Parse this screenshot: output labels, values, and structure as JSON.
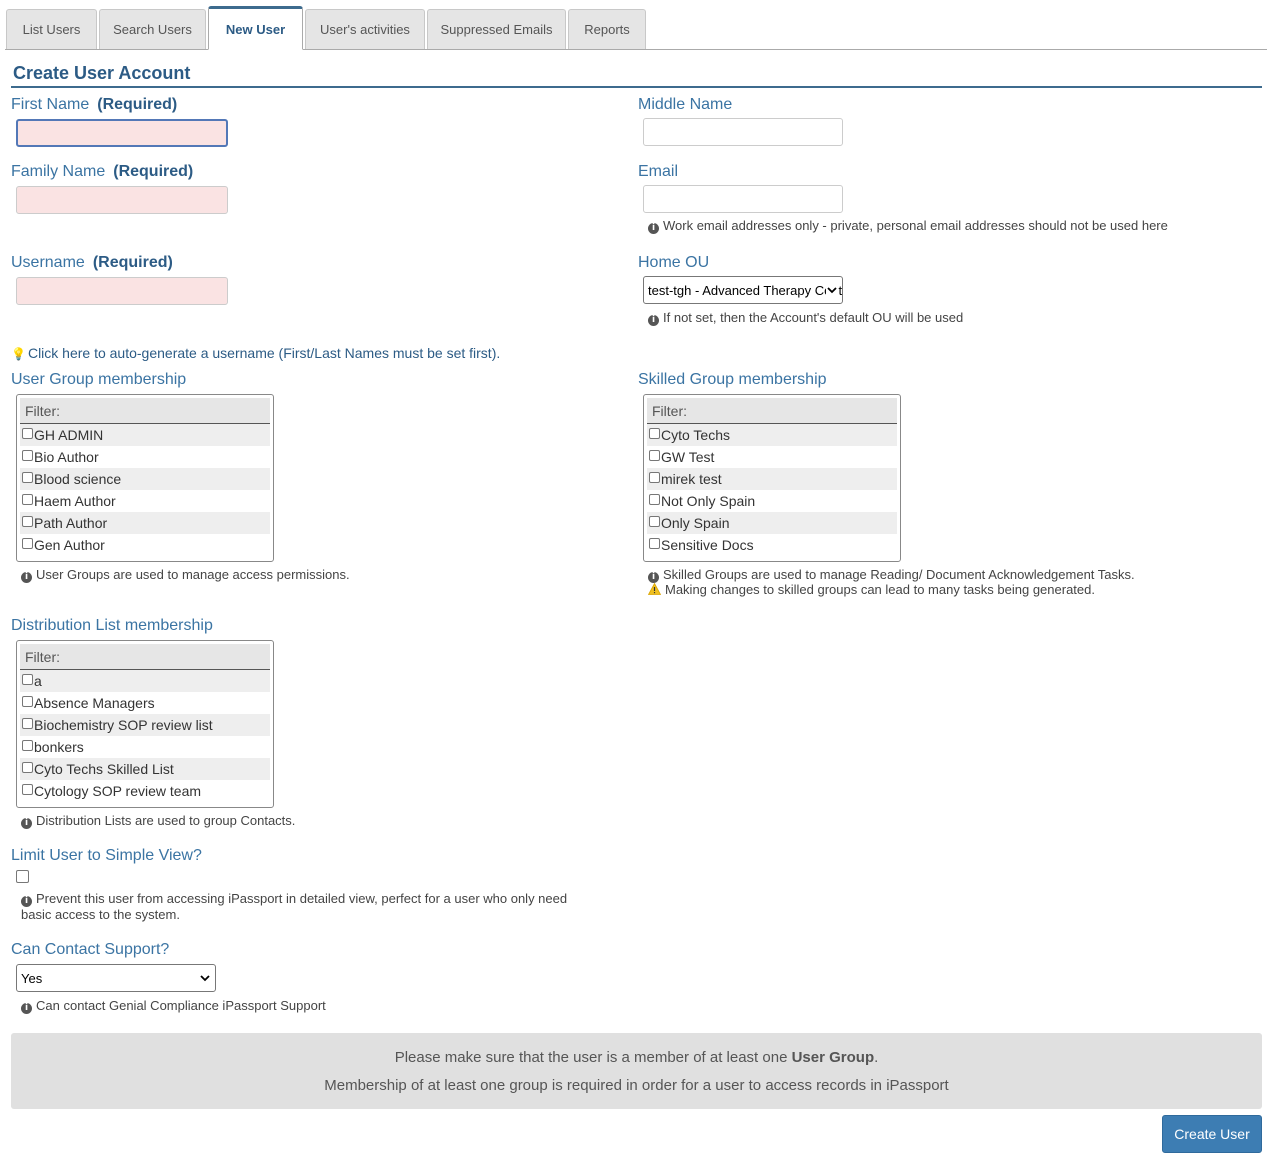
{
  "tabs": [
    {
      "label": "List Users"
    },
    {
      "label": "Search Users"
    },
    {
      "label": "New User"
    },
    {
      "label": "User's activities"
    },
    {
      "label": "Suppressed Emails"
    },
    {
      "label": "Reports"
    }
  ],
  "page_title": "Create User Account",
  "first_name": {
    "label": "First Name",
    "required": "(Required)",
    "value": ""
  },
  "middle_name": {
    "label": "Middle Name",
    "value": ""
  },
  "family_name": {
    "label": "Family Name",
    "required": "(Required)",
    "value": ""
  },
  "email": {
    "label": "Email",
    "value": "",
    "help": "Work email addresses only - private, personal email addresses should not be used here"
  },
  "username": {
    "label": "Username",
    "required": "(Required)",
    "value": ""
  },
  "home_ou": {
    "label": "Home OU",
    "selected": "test-tgh - Advanced Therapy Centre",
    "help": "If not set, then the Account's default OU will be used"
  },
  "autogen_link": "Click here to auto-generate a username (First/Last Names must be set first).",
  "user_groups": {
    "label": "User Group membership",
    "filter": "Filter:",
    "items": [
      "GH ADMIN",
      "Bio Author",
      "Blood science",
      "Haem Author",
      "Path Author",
      "Gen Author"
    ],
    "help": "User Groups are used to manage access permissions."
  },
  "skilled_groups": {
    "label": "Skilled Group membership",
    "filter": "Filter:",
    "items": [
      "Cyto Techs",
      "GW Test",
      "mirek test",
      "Not Only Spain",
      "Only Spain",
      "Sensitive Docs"
    ],
    "help": "Skilled Groups are used to manage Reading/ Document Acknowledgement Tasks.",
    "warning": "Making changes to skilled groups can lead to many tasks being generated."
  },
  "distribution_lists": {
    "label": "Distribution List membership",
    "filter": "Filter:",
    "items": [
      "a",
      "Absence Managers",
      "Biochemistry SOP review list",
      "bonkers",
      "Cyto Techs Skilled List",
      "Cytology SOP review team"
    ],
    "help": "Distribution Lists are used to group Contacts."
  },
  "simple_view": {
    "label": "Limit User to Simple View?",
    "checked": false,
    "help_line1": "Prevent this user from accessing iPassport in detailed view, perfect for a user who only need",
    "help_line2": "basic access to the system."
  },
  "contact_support": {
    "label": "Can Contact Support?",
    "selected": "Yes",
    "help": "Can contact Genial Compliance iPassport Support"
  },
  "notice": {
    "line1_prefix": "Please make sure that the user is a member of at least one ",
    "line1_bold": "User Group",
    "line1_suffix": ".",
    "line2": "Membership of at least one group is required in order for a user to access records in iPassport"
  },
  "create_button": "Create User",
  "colors": {
    "accent": "#2c5b85",
    "label": "#3b74a3",
    "required_bg": "#fae3e3",
    "button": "#3d7db3"
  }
}
